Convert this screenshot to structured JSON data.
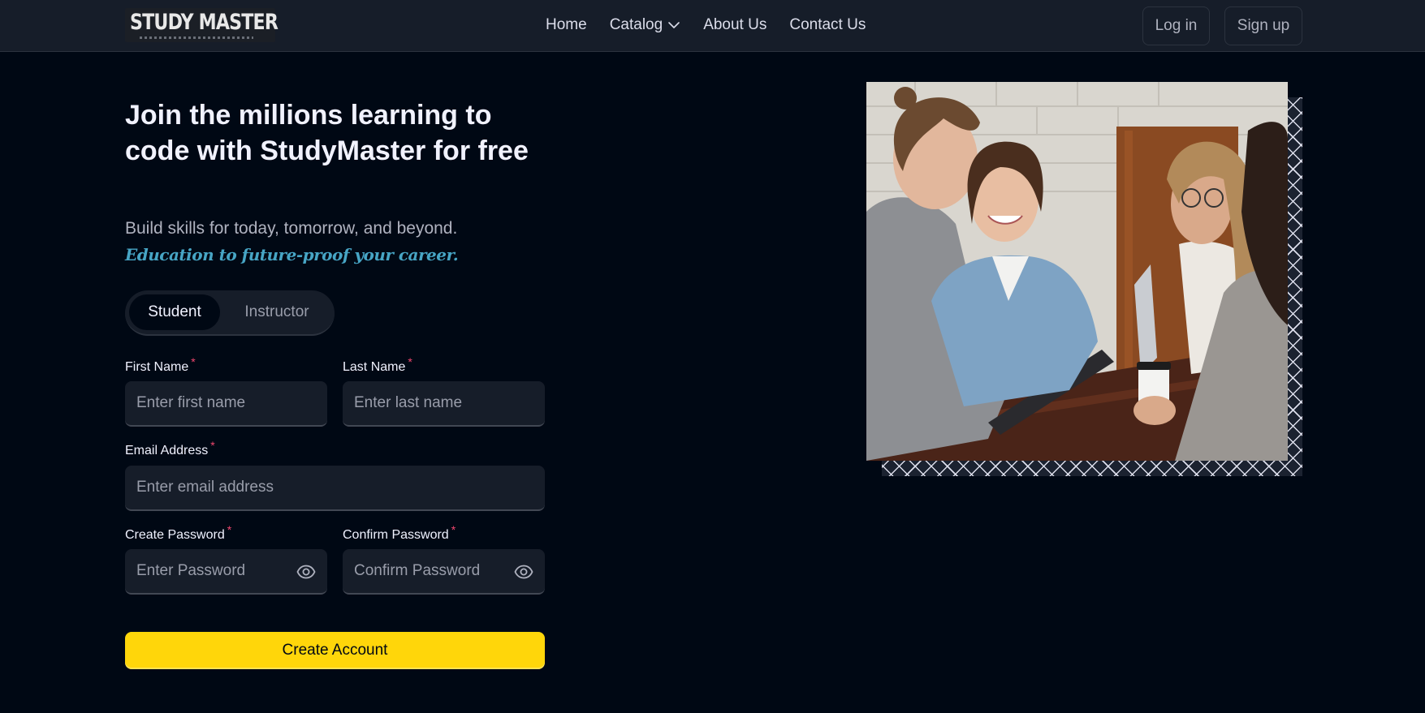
{
  "nav": {
    "logo_text": "STUDY MASTER",
    "links": {
      "home": "Home",
      "catalog": "Catalog",
      "about": "About Us",
      "contact": "Contact Us"
    },
    "login": "Log in",
    "signup": "Sign up"
  },
  "hero": {
    "headline": "Join the millions learning to code with StudyMaster for free",
    "subline": "Build skills for today, tomorrow, and beyond.",
    "tagline": "Education to future-proof your career."
  },
  "toggle": {
    "options": [
      "Student",
      "Instructor"
    ],
    "selected": "Student"
  },
  "form": {
    "first_name": {
      "label": "First Name",
      "placeholder": "Enter first name",
      "value": ""
    },
    "last_name": {
      "label": "Last Name",
      "placeholder": "Enter last name",
      "value": ""
    },
    "email": {
      "label": "Email Address",
      "placeholder": "Enter email address",
      "value": ""
    },
    "password": {
      "label": "Create Password",
      "placeholder": "Enter Password",
      "value": ""
    },
    "confirm_password": {
      "label": "Confirm Password",
      "placeholder": "Confirm Password",
      "value": ""
    },
    "required_mark": "*",
    "submit": "Create Account"
  },
  "icons": {
    "catalog_dropdown": "chevron-down-icon",
    "password_visibility": "eye-icon"
  },
  "colors": {
    "page_bg": "#000814",
    "nav_bg": "#161D29",
    "accent_yellow": "#FFD60A",
    "tagline_blue": "#47A5C5",
    "required_red": "#EF476F"
  }
}
